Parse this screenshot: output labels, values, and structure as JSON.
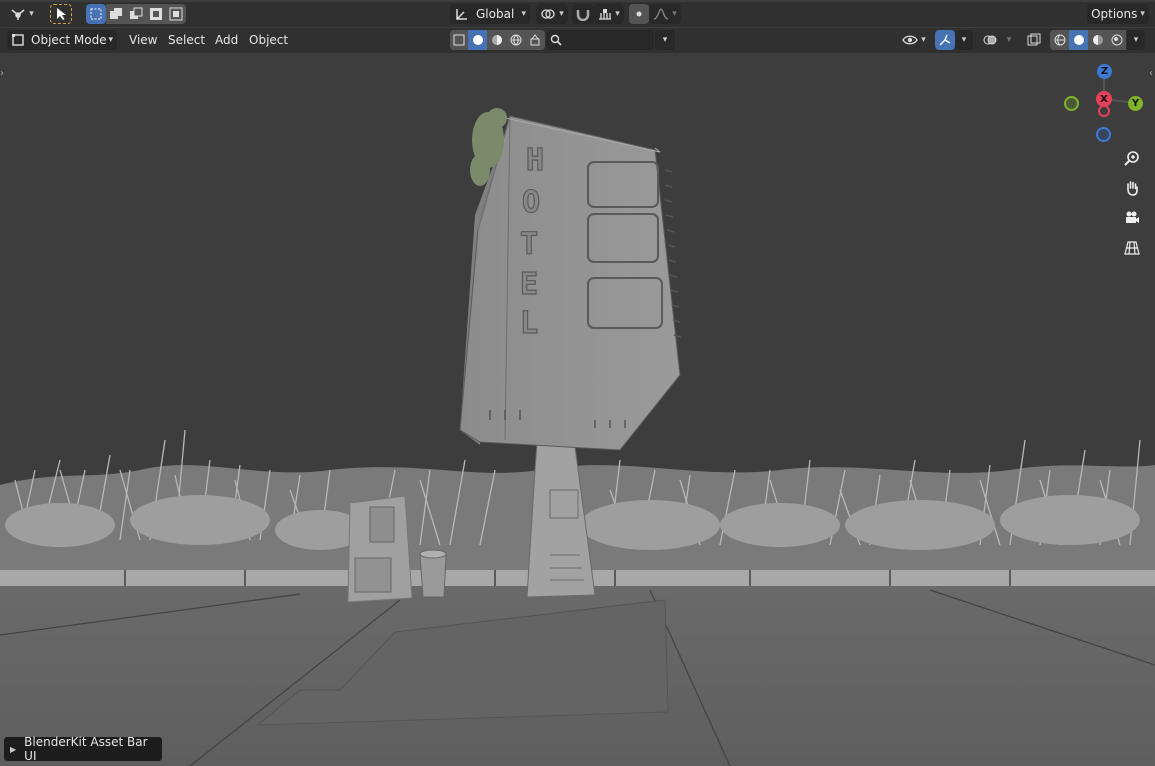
{
  "header_top": {
    "transform_orientation": "Global",
    "options_label": "Options"
  },
  "header_second": {
    "mode": "Object Mode",
    "menus": [
      "View",
      "Select",
      "Add",
      "Object"
    ],
    "search_placeholder": ""
  },
  "scene": {
    "sign_letters": [
      "H",
      "O",
      "T",
      "E",
      "L"
    ]
  },
  "gizmo": {
    "x_label": "X",
    "y_label": "Y",
    "z_label": "Z",
    "colors": {
      "x": "#e5405b",
      "y": "#7fb42a",
      "z": "#3b7bd6"
    }
  },
  "footer": {
    "asset_bar_label": "BlenderKit Asset Bar UI"
  },
  "colors": {
    "header_bg": "#303030",
    "button_bg": "#545454",
    "active_blue": "#4772b3",
    "viewport_bg": "#3d3d3d"
  }
}
